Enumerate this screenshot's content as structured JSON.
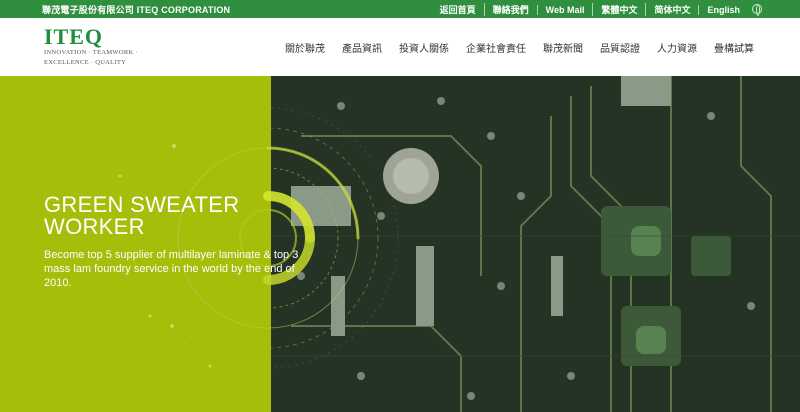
{
  "topbar": {
    "company": "聯茂電子股份有限公司 ITEQ CORPORATION",
    "links": [
      "返回首頁",
      "聯絡我們",
      "Web Mail",
      "繁體中文",
      "简体中文",
      "English"
    ]
  },
  "logo": {
    "mark": "ITEQ",
    "tagline_1": "INNOVATION · TEAMWORK ·",
    "tagline_2": "EXCELLENCE · QUALITY"
  },
  "nav": [
    "關於聯茂",
    "產品資訊",
    "投資人關係",
    "企業社會責任",
    "聯茂新聞",
    "品質認證",
    "人力資源",
    "疊構試算"
  ],
  "hero": {
    "title_1": "GREEN SWEATER",
    "title_2": "WORKER",
    "desc_1": "Become top 5 supplier of multilayer laminate & top 3",
    "desc_2": "mass lam foundry service in the world by the end of",
    "desc_3": "2010."
  },
  "colors": {
    "topbar": "#2f8f3e",
    "hero_green": "#a6bd0a",
    "brand": "#1f8f3a"
  }
}
